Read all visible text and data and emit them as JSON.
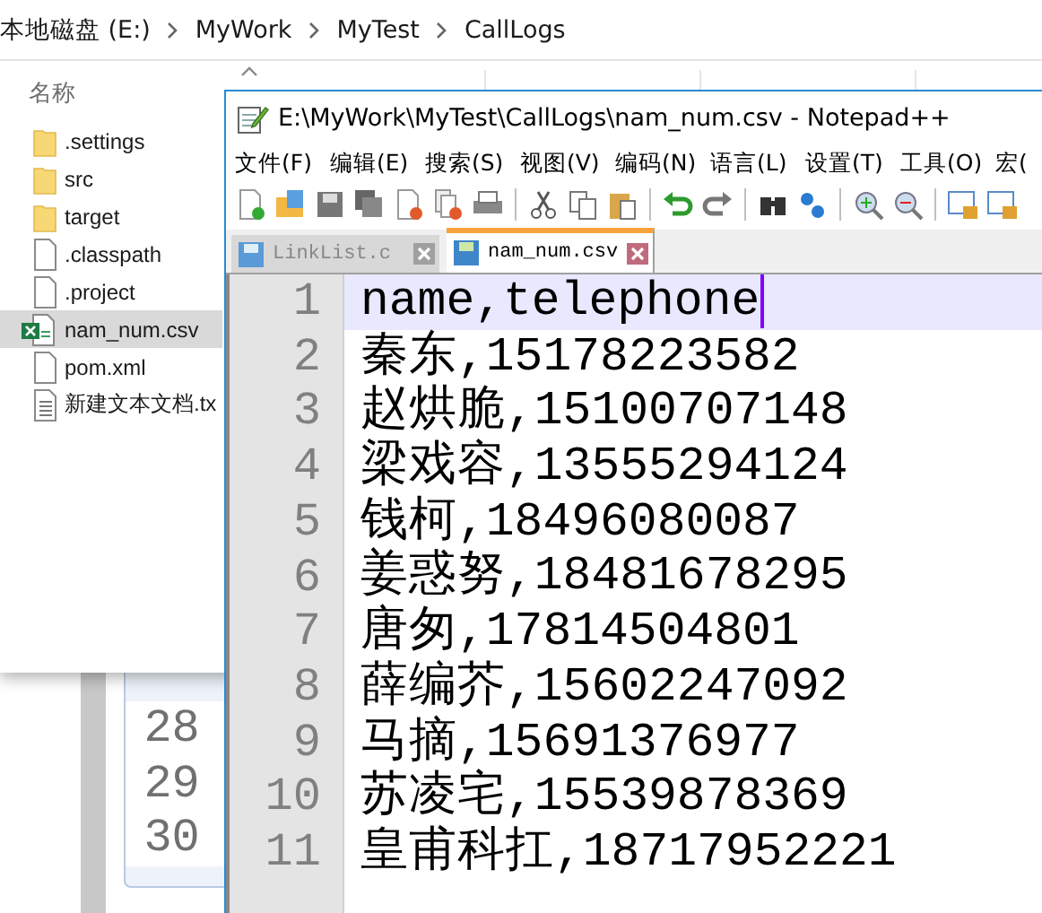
{
  "explorer": {
    "breadcrumb": [
      "本地磁盘 (E:)",
      "MyWork",
      "MyTest",
      "CallLogs"
    ],
    "columns": [
      "名称"
    ],
    "files": [
      {
        "name": ".settings",
        "kind": "folder",
        "selected": false
      },
      {
        "name": "src",
        "kind": "folder",
        "selected": false
      },
      {
        "name": "target",
        "kind": "folder",
        "selected": false
      },
      {
        "name": ".classpath",
        "kind": "file",
        "selected": false
      },
      {
        "name": ".project",
        "kind": "file",
        "selected": false
      },
      {
        "name": "nam_num.csv",
        "kind": "csv",
        "selected": true
      },
      {
        "name": "pom.xml",
        "kind": "file",
        "selected": false
      },
      {
        "name": "新建文本文档.tx",
        "kind": "text",
        "selected": false
      }
    ]
  },
  "background_editor": {
    "line_numbers": [
      "28",
      "29",
      "30"
    ]
  },
  "notepad": {
    "title": "E:\\MyWork\\MyTest\\CallLogs\\nam_num.csv - Notepad++",
    "menu": [
      "文件(F)",
      "编辑(E)",
      "搜索(S)",
      "视图(V)",
      "编码(N)",
      "语言(L)",
      "设置(T)",
      "工具(O)",
      "宏("
    ],
    "tabs": [
      {
        "label": "LinkList.c",
        "selected": false
      },
      {
        "label": "nam_num.csv",
        "selected": true
      }
    ],
    "line_numbers": [
      "1",
      "2",
      "3",
      "4",
      "5",
      "6",
      "7",
      "8",
      "9",
      "10",
      "11"
    ],
    "lines": [
      {
        "text": "name,telephone",
        "current": true
      },
      {
        "text": "秦东,15178223582",
        "current": false
      },
      {
        "text": "赵烘脆,15100707148",
        "current": false
      },
      {
        "text": "梁戏容,13555294124",
        "current": false
      },
      {
        "text": "钱柯,18496080087",
        "current": false
      },
      {
        "text": "姜惑努,18481678295",
        "current": false
      },
      {
        "text": "唐匆,17814504801",
        "current": false
      },
      {
        "text": "薛编芥,15602247092",
        "current": false
      },
      {
        "text": "马摘,15691376977",
        "current": false
      },
      {
        "text": "苏凌宅,15539878369",
        "current": false
      },
      {
        "text": "皇甫科扛,18717952221",
        "current": false
      }
    ]
  }
}
